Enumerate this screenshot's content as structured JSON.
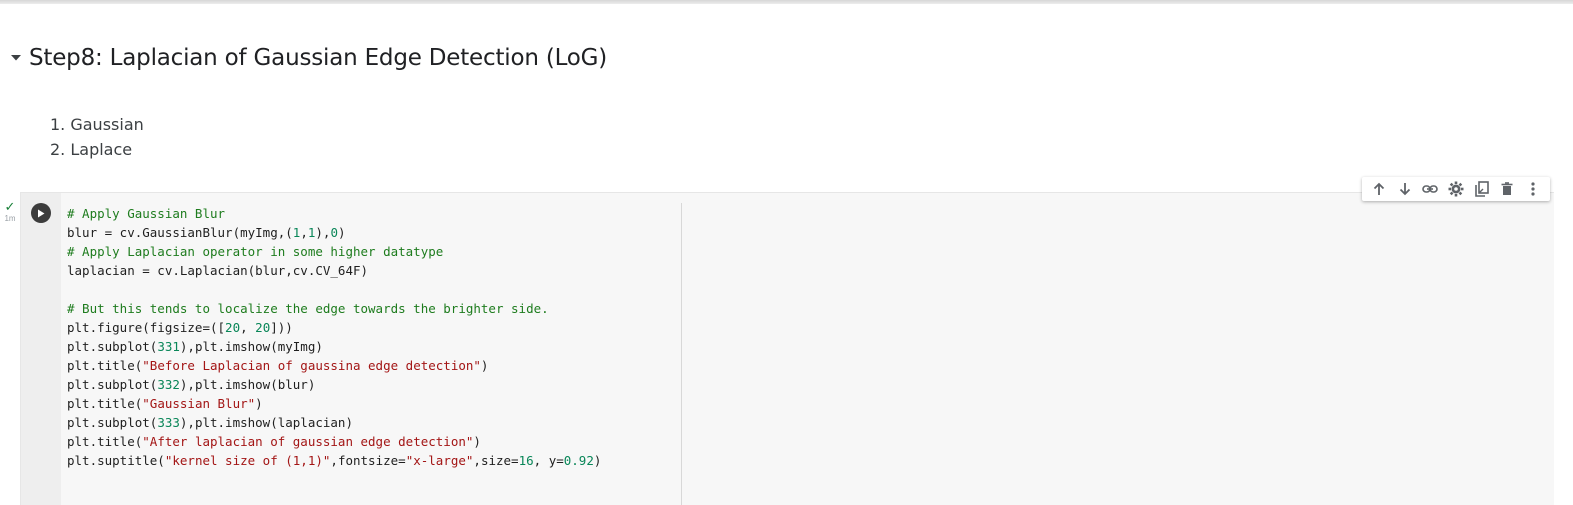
{
  "section": {
    "heading": "Step8: Laplacian of Gaussian Edge Detection (LoG)"
  },
  "steps": [
    "1. Gaussian",
    "2. Laplace"
  ],
  "cell": {
    "exec_check": "✓",
    "exec_time": "1m",
    "code": [
      [
        {
          "t": "# Apply Gaussian Blur",
          "c": "comment"
        }
      ],
      [
        {
          "t": "blur = cv.GaussianBlur(myImg,(",
          "c": "plain"
        },
        {
          "t": "1",
          "c": "number"
        },
        {
          "t": ",",
          "c": "plain"
        },
        {
          "t": "1",
          "c": "number"
        },
        {
          "t": "),",
          "c": "plain"
        },
        {
          "t": "0",
          "c": "number"
        },
        {
          "t": ")",
          "c": "plain"
        }
      ],
      [
        {
          "t": "# Apply Laplacian operator in some higher datatype",
          "c": "comment"
        }
      ],
      [
        {
          "t": "laplacian = cv.Laplacian(blur,cv.CV_64F)",
          "c": "plain"
        }
      ],
      [],
      [
        {
          "t": "# But this tends to localize the edge towards the brighter side.",
          "c": "comment"
        }
      ],
      [
        {
          "t": "plt.figure(figsize=([",
          "c": "plain"
        },
        {
          "t": "20",
          "c": "number"
        },
        {
          "t": ", ",
          "c": "plain"
        },
        {
          "t": "20",
          "c": "number"
        },
        {
          "t": "]))",
          "c": "plain"
        }
      ],
      [
        {
          "t": "plt.subplot(",
          "c": "plain"
        },
        {
          "t": "331",
          "c": "number"
        },
        {
          "t": "),plt.imshow(myImg)",
          "c": "plain"
        }
      ],
      [
        {
          "t": "plt.title(",
          "c": "plain"
        },
        {
          "t": "\"Before Laplacian of gaussina edge detection\"",
          "c": "string"
        },
        {
          "t": ")",
          "c": "plain"
        }
      ],
      [
        {
          "t": "plt.subplot(",
          "c": "plain"
        },
        {
          "t": "332",
          "c": "number"
        },
        {
          "t": "),plt.imshow(blur)",
          "c": "plain"
        }
      ],
      [
        {
          "t": "plt.title(",
          "c": "plain"
        },
        {
          "t": "\"Gaussian Blur\"",
          "c": "string"
        },
        {
          "t": ")",
          "c": "plain"
        }
      ],
      [
        {
          "t": "plt.subplot(",
          "c": "plain"
        },
        {
          "t": "333",
          "c": "number"
        },
        {
          "t": "),plt.imshow(laplacian)",
          "c": "plain"
        }
      ],
      [
        {
          "t": "plt.title(",
          "c": "plain"
        },
        {
          "t": "\"After laplacian of gaussian edge detection\"",
          "c": "string"
        },
        {
          "t": ")",
          "c": "plain"
        }
      ],
      [
        {
          "t": "plt.suptitle(",
          "c": "plain"
        },
        {
          "t": "\"kernel size of (1,1)\"",
          "c": "string"
        },
        {
          "t": ",fontsize=",
          "c": "plain"
        },
        {
          "t": "\"x-large\"",
          "c": "string"
        },
        {
          "t": ",size=",
          "c": "plain"
        },
        {
          "t": "16",
          "c": "number"
        },
        {
          "t": ", y=",
          "c": "plain"
        },
        {
          "t": "0.92",
          "c": "number"
        },
        {
          "t": ")",
          "c": "plain"
        }
      ]
    ]
  },
  "toolbar": [
    "move-up-icon",
    "move-down-icon",
    "link-icon",
    "gear-icon",
    "mirror-cell-icon",
    "trash-icon",
    "more-vert-icon"
  ],
  "colors": {
    "comment": "#1e7c1e",
    "string": "#a31515",
    "number": "#098658",
    "plain": "#1f1f1f",
    "icon": "#5f6368",
    "check": "#188038"
  }
}
